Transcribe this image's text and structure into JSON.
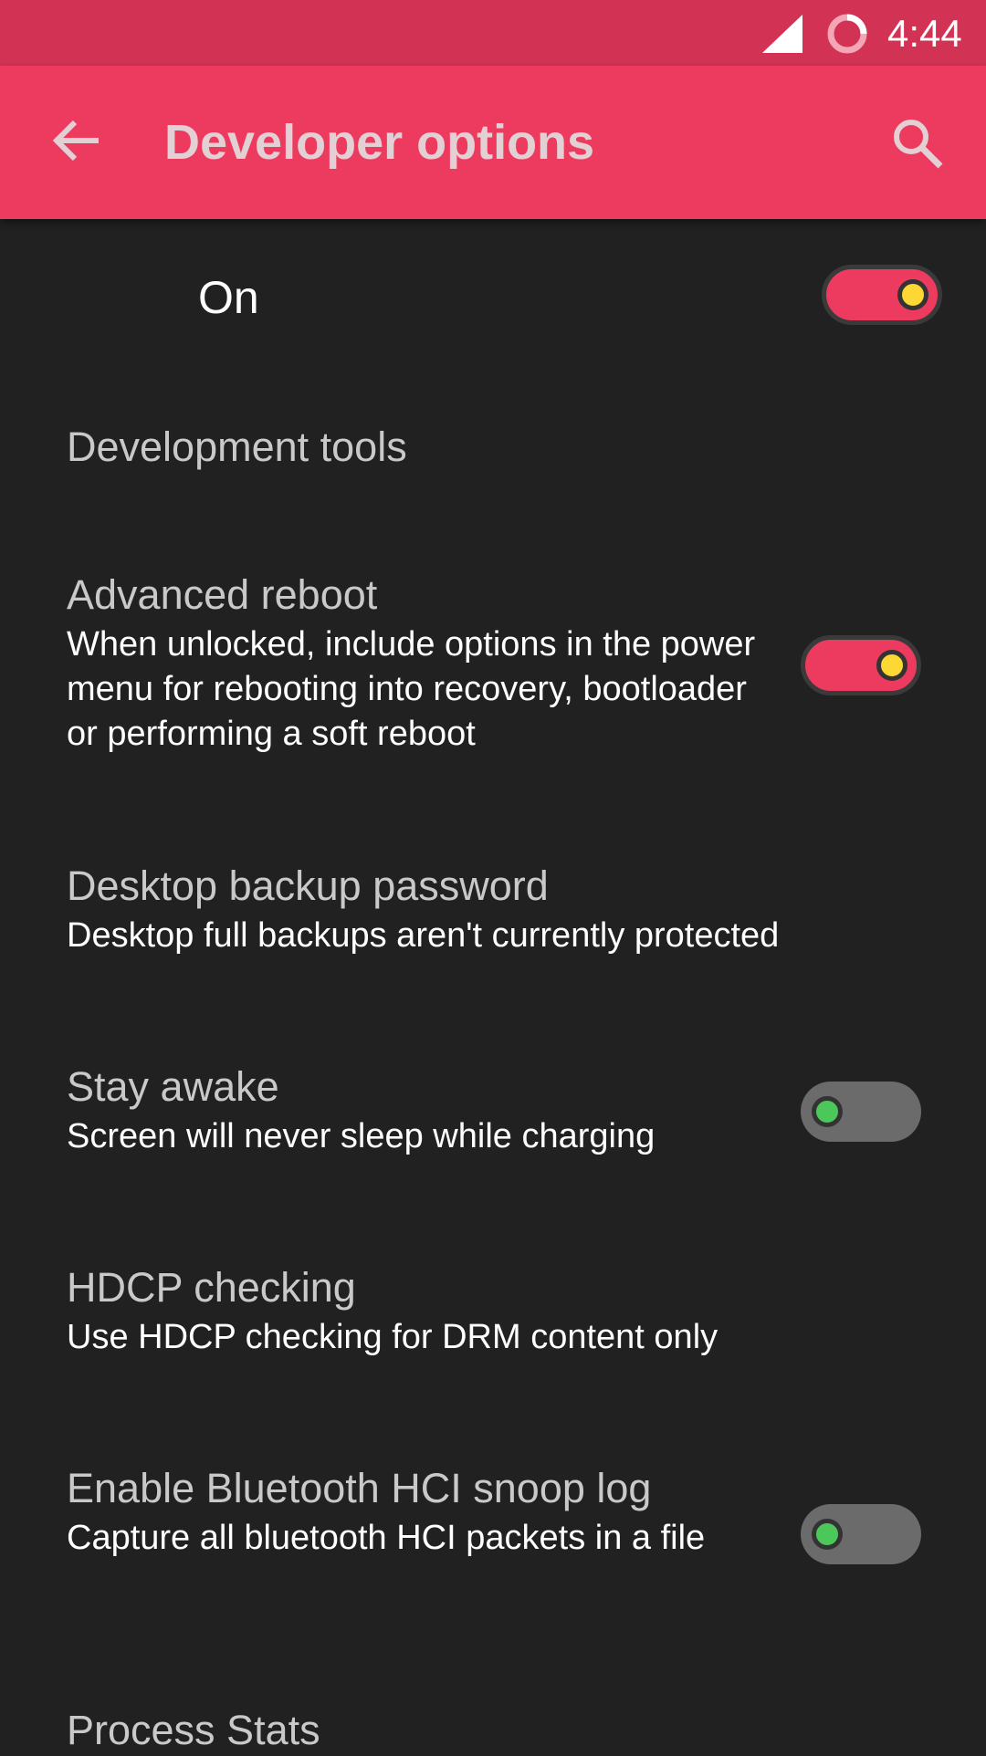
{
  "status_bar": {
    "time": "4:44",
    "signal_icon": "cell-signal-icon",
    "battery_icon": "battery-ring-icon"
  },
  "app_bar": {
    "back_icon": "arrow-back-icon",
    "title": "Developer options",
    "search_icon": "search-icon",
    "color": "#ed3b60"
  },
  "master_toggle": {
    "label": "On",
    "state": "on"
  },
  "section": {
    "header": "Development tools"
  },
  "preferences": [
    {
      "title": "Advanced reboot",
      "summary": "When unlocked, include options in the power menu for rebooting into recovery, bootloader or performing a soft reboot",
      "toggle": "on"
    },
    {
      "title": "Desktop backup password",
      "summary": "Desktop full backups aren't currently protected"
    },
    {
      "title": "Stay awake",
      "summary": "Screen will never sleep while charging",
      "toggle": "off"
    },
    {
      "title": "HDCP checking",
      "summary": "Use HDCP checking for DRM content only"
    },
    {
      "title": "Enable Bluetooth HCI snoop log",
      "summary": "Capture all bluetooth HCI packets in a file",
      "toggle": "off"
    },
    {
      "title": "Process Stats"
    }
  ],
  "colors": {
    "accent": "#ed3b60",
    "status_bar": "#d23354",
    "background": "#212121",
    "knob_on": "#fdd835",
    "knob_off": "#4cc85b"
  }
}
